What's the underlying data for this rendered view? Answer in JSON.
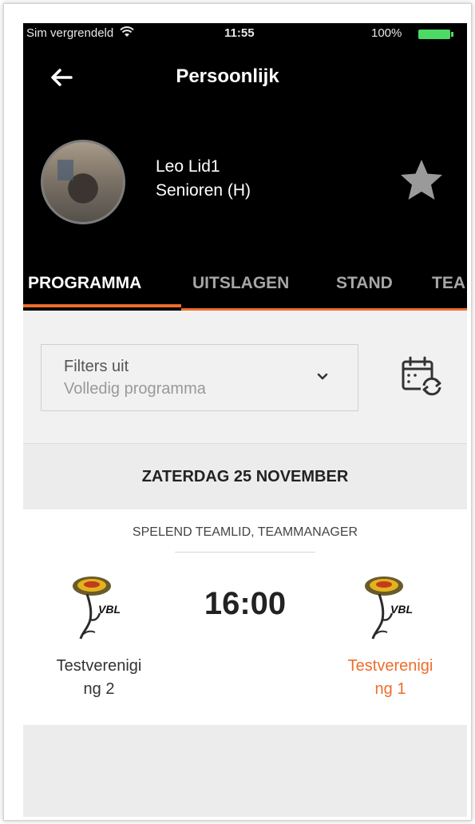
{
  "statusbar": {
    "carrier": "Sim vergrendeld",
    "time": "11:55",
    "battery": "100%"
  },
  "header": {
    "title": "Persoonlijk",
    "profile_name": "Leo Lid1",
    "profile_team": "Senioren (H)"
  },
  "tabs": [
    {
      "label": "PROGRAMMA",
      "active": true
    },
    {
      "label": "UITSLAGEN",
      "active": false
    },
    {
      "label": "STAND",
      "active": false
    },
    {
      "label": "TEA",
      "active": false
    }
  ],
  "filter": {
    "label": "Filters uit",
    "value": "Volledig programma"
  },
  "date_header": "ZATERDAG 25 NOVEMBER",
  "match": {
    "roles": "SPELEND TEAMLID, TEAMMANAGER",
    "time": "16:00",
    "home_team": "Testverenigi\nng 2",
    "away_team": "Testverenigi\nng 1",
    "logo_text": "VBL"
  },
  "colors": {
    "accent": "#ee6d2c",
    "header_bg": "#000000",
    "battery": "#4cd964"
  }
}
